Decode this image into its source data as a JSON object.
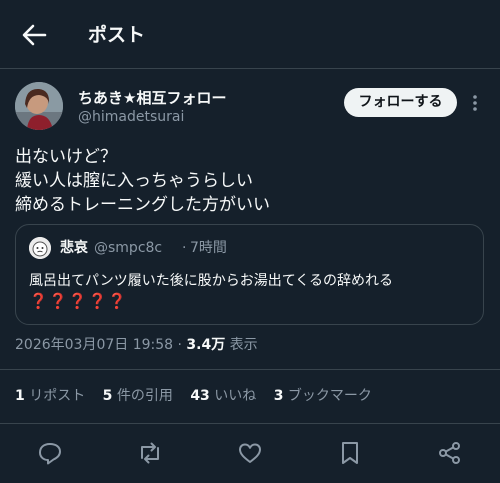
{
  "header": {
    "title": "ポスト"
  },
  "author": {
    "name": "ちあき★相互フォロー",
    "handle": "@himadetsurai"
  },
  "follow_button": {
    "label": "フォローする"
  },
  "post": {
    "lines": [
      "出ないけど？",
      "緩い人は膣に入っちゃうらしい",
      "締めるトレーニングした方がいい"
    ]
  },
  "quoted": {
    "name": "悲哀",
    "handle": "@smpc8c",
    "separator": "·",
    "time": "7時間",
    "text": "風呂出てパンツ履いた後に股からお湯出てくるの辞めれる",
    "emoji": "❓❓❓❓❓"
  },
  "meta": {
    "timestamp": "2026年03月07日 19:58",
    "separator": "·",
    "views": "3.4万",
    "views_label": "表示"
  },
  "stats": [
    {
      "num": "1",
      "label": "リポスト"
    },
    {
      "num": "5",
      "label": "件の引用"
    },
    {
      "num": "43",
      "label": "いいね"
    },
    {
      "num": "3",
      "label": "ブックマーク"
    }
  ],
  "icons": {
    "back": "arrow-left-icon",
    "more": "more-vertical-icon",
    "reply": "reply-icon",
    "repost": "repost-icon",
    "like": "heart-icon",
    "bookmark": "bookmark-icon",
    "share": "share-icon"
  },
  "colors": {
    "background": "#15202b",
    "divider": "#38444d",
    "secondary_text": "#8b98a5",
    "quote_emoji": "#e0245e"
  }
}
